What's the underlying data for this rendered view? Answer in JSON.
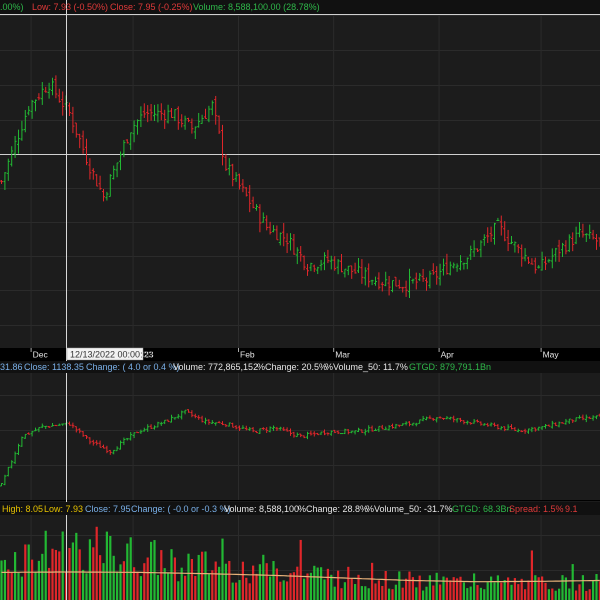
{
  "colors": {
    "up": "#22b833",
    "down": "#e0262a",
    "volume_ma": "#e8b27a",
    "label_white": "#e6e6e6",
    "label_blue": "#7ab0e8",
    "label_green": "#2fb84a",
    "label_red": "#e03a3a",
    "label_yellow": "#e6c200",
    "crosshair": "#d8d8d8",
    "panel_bg": "#1c1c1c",
    "grid": "#2b2b2b"
  },
  "top_info": {
    "pct_fragment": ".00%)",
    "low": "Low: 7.93 (-0.50%)",
    "close": "Close: 7.95 (-0.25%)",
    "volume": "Volume: 8,588,100.00 (28.78%)"
  },
  "x_axis": {
    "ticks": [
      {
        "label": "Dec",
        "day": 9
      },
      {
        "label": "2023",
        "day": 39
      },
      {
        "label": "Feb",
        "day": 70
      },
      {
        "label": "Mar",
        "day": 98
      },
      {
        "label": "Apr",
        "day": 129
      },
      {
        "label": "May",
        "day": 159
      }
    ],
    "cursor_label": "12/13/2022 00:00:00"
  },
  "index_info": {
    "prefix": "31.86",
    "close": "Close: 1138.35",
    "change": "Change: ( 4.0 or 0.4 %)",
    "volume": "Volume: 772,865,152",
    "pct_change": "%Change: 20.5%",
    "volume_50": "%Volume_50: 11.7%",
    "gtgd": "GTGD: 879,791.1Bn"
  },
  "volume_info": {
    "high": "High: 8.05",
    "low": "Low: 7.93",
    "close": "Close: 7.95",
    "change": "Change: ( -0.0 or -0.3 %)",
    "volume": "Volume: 8,588,100",
    "pct_change": "%Change: 28.8%",
    "volume_50": "%Volume_50: -31.7%",
    "gtgd": "GTGD: 68.3Bn",
    "spread": "Spread: 1.5%",
    "tail": "9.1"
  },
  "chart_data": [
    {
      "type": "candlestick",
      "title": "",
      "x_axis": "trading days, Nov 2022 - May 2023",
      "anchors_x_day": [
        0,
        8,
        14,
        20,
        26,
        30,
        38,
        42,
        50,
        56,
        62,
        66,
        72,
        78,
        84,
        90,
        96,
        102,
        110,
        118,
        126,
        132,
        138,
        146,
        152,
        158,
        164,
        170,
        176
      ],
      "anchors_close": [
        8.1,
        8.6,
        8.75,
        8.55,
        8.2,
        8.0,
        8.45,
        8.55,
        8.55,
        8.45,
        8.6,
        8.2,
        8.0,
        7.8,
        7.72,
        7.55,
        7.58,
        7.52,
        7.45,
        7.42,
        7.45,
        7.55,
        7.62,
        7.8,
        7.65,
        7.52,
        7.65,
        7.75,
        7.7
      ],
      "y_range": [
        7.0,
        9.2
      ]
    },
    {
      "type": "candlestick",
      "title": "",
      "name": "index",
      "anchors_x_day": [
        0,
        6,
        12,
        20,
        26,
        32,
        40,
        48,
        54,
        60,
        66,
        74,
        80,
        88,
        96,
        104,
        112,
        120,
        128,
        136,
        144,
        152,
        160,
        168,
        176
      ],
      "anchors_close": [
        1075,
        1125,
        1135,
        1138,
        1120,
        1110,
        1130,
        1140,
        1150,
        1140,
        1138,
        1130,
        1134,
        1125,
        1130,
        1130,
        1134,
        1138,
        1145,
        1141,
        1136,
        1131,
        1135,
        1142,
        1145
      ],
      "y_range": [
        1060,
        1190
      ]
    },
    {
      "type": "bar",
      "title": "",
      "name": "volume",
      "anchors_x_day": [
        0,
        20,
        40,
        60,
        80,
        100,
        120,
        140,
        160,
        176
      ],
      "anchors_volume_m": [
        9.0,
        12.5,
        10.0,
        8.0,
        7.0,
        5.5,
        4.5,
        4.0,
        4.0,
        4.2
      ],
      "ma_anchors_m": [
        6.5,
        6.6,
        6.5,
        6.2,
        5.8,
        5.2,
        4.6,
        4.3,
        4.4,
        4.6
      ],
      "y_range": [
        0,
        20
      ]
    }
  ]
}
